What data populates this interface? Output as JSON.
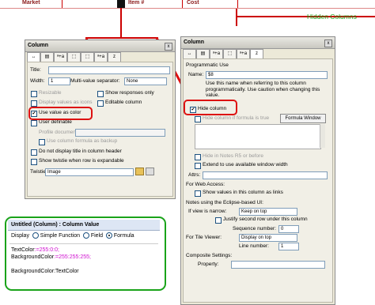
{
  "header": {
    "col1": "Market",
    "col2": "Item #",
    "col3": "Cost",
    "hidden_columns": "Hidden Columns"
  },
  "left_panel": {
    "title": "Column",
    "close": "x",
    "tabs": [
      "↔",
      "▤",
      "ᵃ+a",
      "⬚",
      "⬚",
      "ᵃ+a",
      "z"
    ],
    "title_label": "Title:",
    "width_label": "Width:",
    "width_value": "1",
    "multivalue_label": "Multi-value separator:",
    "multivalue_value": "None",
    "resizable": "Resizable",
    "show_responses_only": "Show responses only",
    "display_values_as_icons": "Display values as icons",
    "editable_column": "Editable column",
    "use_value_as_color": "Use value as color",
    "user_definable": "User definable",
    "profile_document": "Profile document",
    "use_column_formula_as_backup": "Use column formula as backup",
    "do_not_display_title": "Do not display title in column header",
    "show_twistie": "Show twistie when row is expandable",
    "twistie_label": "Twistie",
    "twistie_value": "Image"
  },
  "right_panel": {
    "title": "Column",
    "close": "x",
    "tabs": [
      "↔",
      "▤",
      "ᵃ+a",
      "⬚",
      "ᵃ+a",
      "z"
    ],
    "programmatic_use": "Programmatic Use",
    "name_label": "Name:",
    "name_value": "$8",
    "name_help": "Use this name when referring to this column programmatically. Use caution when changing this value.",
    "hide_column": "Hide column",
    "hide_if_formula": "Hide column if formula is true",
    "formula_window_button": "Formula Window",
    "hide_in_notes": "Hide in Notes R5 or before",
    "extend_to_window": "Extend to use available window width",
    "attrs_label": "Attrs:",
    "for_web_access": "For Web Access:",
    "show_values_as_links": "Show values in this column as links",
    "notes_using": "Notes using the   Eclipse-based UI:",
    "if_view_narrow_label": "If view is narrow:",
    "if_view_narrow_value": "Keep on top",
    "justify_second_row": "Justify second row under this column",
    "sequence_label": "Sequence number:",
    "sequence_value": "0",
    "for_tile_viewer": "For Tile Viewer:",
    "tile_value": "Display on top",
    "line_number_label": "Line number:",
    "line_number_value": "1",
    "composite_settings": "Composite Settings:",
    "property_label": "Property:"
  },
  "formula_window": {
    "title": "Untitled (Column) : Column Value",
    "display_label": "Display",
    "opt_simple": "Simple Function",
    "opt_field": "Field",
    "opt_formula": "Formula",
    "line1_a": "TextColor",
    "line1_b": ":=255:0:0;",
    "line2_a": "BackgroundColor",
    "line2_b": ":=255:255:255;",
    "line3": "BackgroundColor:TextColor"
  },
  "colors": {
    "annotation_red": "#d11111",
    "annotation_green": "#1aa31a",
    "formula_magenta": "#d010d0"
  }
}
